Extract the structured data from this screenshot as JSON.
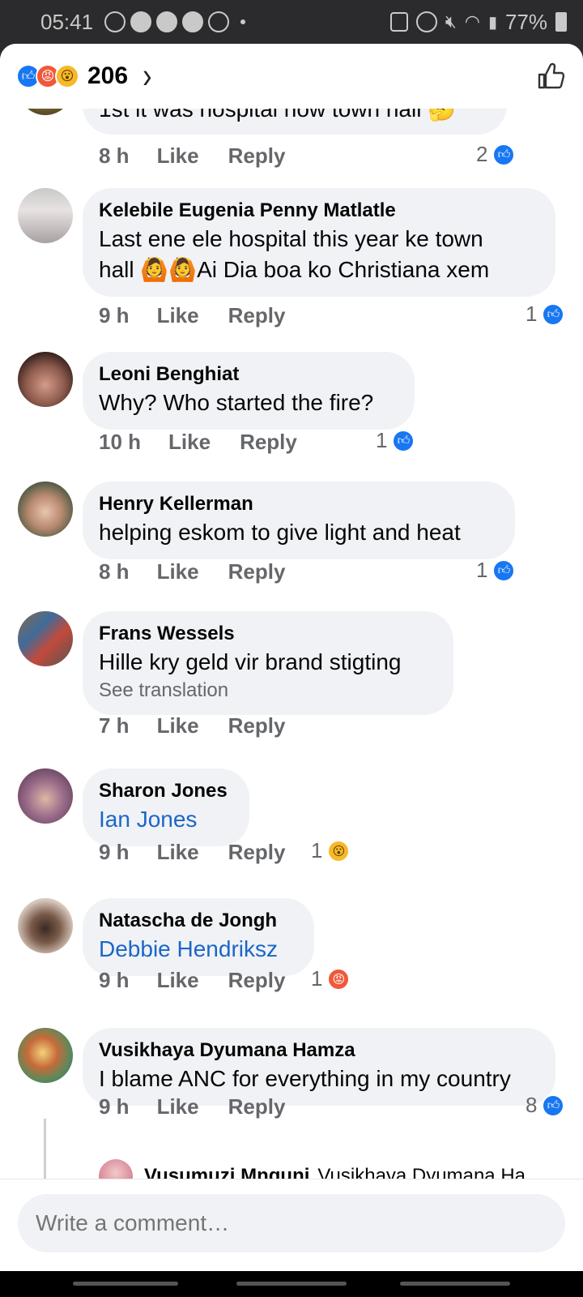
{
  "status_bar": {
    "time": "05:41",
    "battery": "77%",
    "icons": [
      "whatsapp-icon",
      "app-icon",
      "app-icon",
      "app-icon",
      "recycle-icon",
      "dot",
      "lock-icon",
      "alarm-icon",
      "mute-icon",
      "wifi-icon",
      "signal-icon",
      "battery-icon"
    ]
  },
  "header": {
    "reaction_icons": [
      "like",
      "angry",
      "wow"
    ],
    "reaction_count": "206",
    "chevron": "›",
    "like_button_icon": "thumbs-up-outline-icon"
  },
  "comments": [
    {
      "id": "c0",
      "text": "1st it was hospital now town hall 🤔",
      "time": "8 h",
      "like_label": "Like",
      "reply_label": "Reply",
      "reaction_count": "2",
      "reaction": "like"
    },
    {
      "id": "c1",
      "name": "Kelebile Eugenia Penny Matlatle",
      "text_line1": "Last ene ele hospital this year ke town",
      "text_line2": "hall 🙆🙆Ai Dia boa ko Christiana xem",
      "time": "9 h",
      "like_label": "Like",
      "reply_label": "Reply",
      "reaction_count": "1",
      "reaction": "like"
    },
    {
      "id": "c2",
      "name": "Leoni Benghiat",
      "text": "Why? Who started the fire?",
      "time": "10 h",
      "like_label": "Like",
      "reply_label": "Reply",
      "reaction_count": "1",
      "reaction": "like"
    },
    {
      "id": "c3",
      "name": "Henry Kellerman",
      "text": "helping eskom to give light and heat",
      "time": "8 h",
      "like_label": "Like",
      "reply_label": "Reply",
      "reaction_count": "1",
      "reaction": "like"
    },
    {
      "id": "c4",
      "name": "Frans Wessels",
      "text": "Hille kry geld vir brand stigting",
      "see_translation": "See translation",
      "time": "7 h",
      "like_label": "Like",
      "reply_label": "Reply"
    },
    {
      "id": "c5",
      "name": "Sharon Jones",
      "text": "Ian Jones",
      "time": "9 h",
      "like_label": "Like",
      "reply_label": "Reply",
      "reaction_count": "1",
      "reaction": "wow"
    },
    {
      "id": "c6",
      "name": "Natascha de Jongh",
      "text": "Debbie Hendriksz",
      "time": "9 h",
      "like_label": "Like",
      "reply_label": "Reply",
      "reaction_count": "1",
      "reaction": "angry"
    },
    {
      "id": "c7",
      "name": "Vusikhaya Dyumana Hamza",
      "text": "I blame ANC for everything in my country",
      "time": "9 h",
      "like_label": "Like",
      "reply_label": "Reply",
      "reaction_count": "8",
      "reaction": "like"
    }
  ],
  "reply_preview": {
    "name": "Vusumuzi Mnguni",
    "text": "Vusikhaya Dyumana Ha..."
  },
  "composer": {
    "placeholder": "Write a comment…"
  },
  "colors": {
    "brand_blue": "#1877f2",
    "bubble_bg": "#f0f2f5",
    "meta_gray": "#65676b",
    "link_blue": "#1c66c7"
  }
}
